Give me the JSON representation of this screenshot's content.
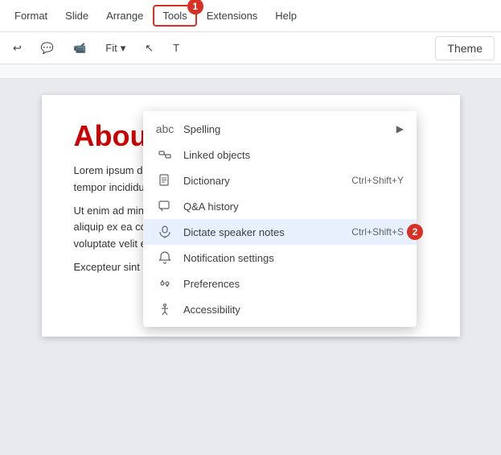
{
  "menubar": {
    "items": [
      {
        "label": "Format",
        "active": false
      },
      {
        "label": "Slide",
        "active": false
      },
      {
        "label": "Arrange",
        "active": false
      },
      {
        "label": "Tools",
        "active": true,
        "badge": "1"
      },
      {
        "label": "Extensions",
        "active": false
      },
      {
        "label": "Help",
        "active": false
      }
    ]
  },
  "toolbar": {
    "fit_label": "Fit",
    "theme_label": "Theme"
  },
  "dropdown": {
    "items": [
      {
        "id": "spelling",
        "icon": "✓",
        "label": "Spelling",
        "shortcut": "",
        "arrow": true,
        "highlighted": false
      },
      {
        "id": "linked-objects",
        "icon": "🔗",
        "label": "Linked objects",
        "shortcut": "",
        "arrow": false,
        "highlighted": false
      },
      {
        "id": "dictionary",
        "icon": "📖",
        "label": "Dictionary",
        "shortcut": "Ctrl+Shift+Y",
        "arrow": false,
        "highlighted": false
      },
      {
        "id": "qa-history",
        "icon": "💬",
        "label": "Q&A history",
        "shortcut": "",
        "arrow": false,
        "highlighted": false
      },
      {
        "id": "dictate",
        "icon": "🎤",
        "label": "Dictate speaker notes",
        "shortcut": "Ctrl+Shift+S",
        "arrow": false,
        "highlighted": true,
        "badge": "2"
      },
      {
        "id": "notification",
        "icon": "🔔",
        "label": "Notification settings",
        "shortcut": "",
        "arrow": false,
        "highlighted": false
      },
      {
        "id": "preferences",
        "icon": "⚙",
        "label": "Preferences",
        "shortcut": "",
        "arrow": false,
        "highlighted": false
      },
      {
        "id": "accessibility",
        "icon": "♿",
        "label": "Accessibility",
        "shortcut": "",
        "arrow": false,
        "highlighted": false
      }
    ]
  },
  "slide": {
    "title": "About",
    "paragraphs": [
      "Lorem ipsum dolor sit amet, consectetur adipiscing elit, sed do eiusmod tempor incididunt ut labore et dolore magna aliqua.",
      "Ut enim ad minim veniam, quis nostrud exercitation ullamco laboris nisi ut aliquip ex ea commodo consequat. Duis aute irure dolor in reprehenderit in voluptate velit esse cillum dolore eu fugiat nulla pariatur.",
      "Excepteur sint occaecat cupidatat non proident!"
    ]
  },
  "icons": {
    "spelling": "abc",
    "linked_objects": "⛓",
    "dictionary": "📚",
    "qa": "💬",
    "dictate": "🎙",
    "notification": "🔔",
    "preferences": "👥",
    "accessibility": "♿",
    "fit": "⊞",
    "cursor": "↖"
  }
}
